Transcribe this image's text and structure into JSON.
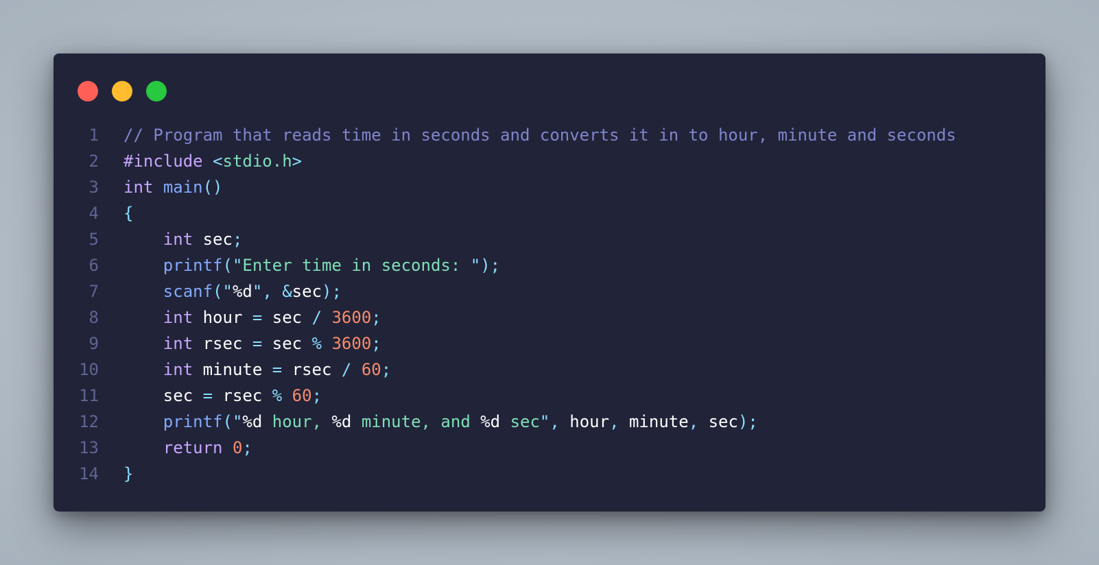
{
  "window": {
    "controls": [
      {
        "name": "close",
        "color": "#ff5f57"
      },
      {
        "name": "minimize",
        "color": "#febc2e"
      },
      {
        "name": "maximize",
        "color": "#28c840"
      }
    ]
  },
  "colors": {
    "background": "#212338",
    "line_number": "#5e6594",
    "comment": "#7f86cc",
    "keyword": "#c7a6ff",
    "function": "#82aaff",
    "punctuation": "#89ddff",
    "string": "#7fe0b8",
    "number": "#f78c6c",
    "identifier": "#ffffff"
  },
  "code": {
    "language": "c",
    "lines": [
      {
        "number": "1",
        "tokens": [
          {
            "t": "comment",
            "v": "// Program that reads time in seconds and converts it in to hour, minute and seconds"
          }
        ]
      },
      {
        "number": "2",
        "tokens": [
          {
            "t": "preproc",
            "v": "#include"
          },
          {
            "t": "ident",
            "v": " "
          },
          {
            "t": "punct",
            "v": "<"
          },
          {
            "t": "header",
            "v": "stdio.h"
          },
          {
            "t": "punct",
            "v": ">"
          }
        ]
      },
      {
        "number": "3",
        "tokens": [
          {
            "t": "keyword",
            "v": "int"
          },
          {
            "t": "ident",
            "v": " "
          },
          {
            "t": "func",
            "v": "main"
          },
          {
            "t": "punct",
            "v": "()"
          }
        ]
      },
      {
        "number": "4",
        "tokens": [
          {
            "t": "punct",
            "v": "{"
          }
        ]
      },
      {
        "number": "5",
        "tokens": [
          {
            "t": "ident",
            "v": "    "
          },
          {
            "t": "keyword",
            "v": "int"
          },
          {
            "t": "ident",
            "v": " sec"
          },
          {
            "t": "punct",
            "v": ";"
          }
        ]
      },
      {
        "number": "6",
        "tokens": [
          {
            "t": "ident",
            "v": "    "
          },
          {
            "t": "func",
            "v": "printf"
          },
          {
            "t": "punct",
            "v": "("
          },
          {
            "t": "punct",
            "v": "\""
          },
          {
            "t": "string",
            "v": "Enter time in seconds: "
          },
          {
            "t": "punct",
            "v": "\""
          },
          {
            "t": "punct",
            "v": ");"
          }
        ]
      },
      {
        "number": "7",
        "tokens": [
          {
            "t": "ident",
            "v": "    "
          },
          {
            "t": "func",
            "v": "scanf"
          },
          {
            "t": "punct",
            "v": "("
          },
          {
            "t": "punct",
            "v": "\""
          },
          {
            "t": "ident",
            "v": "%d"
          },
          {
            "t": "punct",
            "v": "\""
          },
          {
            "t": "punct",
            "v": ", "
          },
          {
            "t": "punct",
            "v": "&"
          },
          {
            "t": "ident",
            "v": "sec"
          },
          {
            "t": "punct",
            "v": ");"
          }
        ]
      },
      {
        "number": "8",
        "tokens": [
          {
            "t": "ident",
            "v": "    "
          },
          {
            "t": "keyword",
            "v": "int"
          },
          {
            "t": "ident",
            "v": " hour "
          },
          {
            "t": "punct",
            "v": "="
          },
          {
            "t": "ident",
            "v": " sec "
          },
          {
            "t": "punct",
            "v": "/"
          },
          {
            "t": "ident",
            "v": " "
          },
          {
            "t": "number",
            "v": "3600"
          },
          {
            "t": "punct",
            "v": ";"
          }
        ]
      },
      {
        "number": "9",
        "tokens": [
          {
            "t": "ident",
            "v": "    "
          },
          {
            "t": "keyword",
            "v": "int"
          },
          {
            "t": "ident",
            "v": " rsec "
          },
          {
            "t": "punct",
            "v": "="
          },
          {
            "t": "ident",
            "v": " sec "
          },
          {
            "t": "punct",
            "v": "%"
          },
          {
            "t": "ident",
            "v": " "
          },
          {
            "t": "number",
            "v": "3600"
          },
          {
            "t": "punct",
            "v": ";"
          }
        ]
      },
      {
        "number": "10",
        "tokens": [
          {
            "t": "ident",
            "v": "    "
          },
          {
            "t": "keyword",
            "v": "int"
          },
          {
            "t": "ident",
            "v": " minute "
          },
          {
            "t": "punct",
            "v": "="
          },
          {
            "t": "ident",
            "v": " rsec "
          },
          {
            "t": "punct",
            "v": "/"
          },
          {
            "t": "ident",
            "v": " "
          },
          {
            "t": "number",
            "v": "60"
          },
          {
            "t": "punct",
            "v": ";"
          }
        ]
      },
      {
        "number": "11",
        "tokens": [
          {
            "t": "ident",
            "v": "    sec "
          },
          {
            "t": "punct",
            "v": "="
          },
          {
            "t": "ident",
            "v": " rsec "
          },
          {
            "t": "punct",
            "v": "%"
          },
          {
            "t": "ident",
            "v": " "
          },
          {
            "t": "number",
            "v": "60"
          },
          {
            "t": "punct",
            "v": ";"
          }
        ]
      },
      {
        "number": "12",
        "tokens": [
          {
            "t": "ident",
            "v": "    "
          },
          {
            "t": "func",
            "v": "printf"
          },
          {
            "t": "punct",
            "v": "("
          },
          {
            "t": "punct",
            "v": "\""
          },
          {
            "t": "ident",
            "v": "%d"
          },
          {
            "t": "string",
            "v": " hour, "
          },
          {
            "t": "ident",
            "v": "%d"
          },
          {
            "t": "string",
            "v": " minute, and "
          },
          {
            "t": "ident",
            "v": "%d"
          },
          {
            "t": "string",
            "v": " sec"
          },
          {
            "t": "punct",
            "v": "\""
          },
          {
            "t": "punct",
            "v": ", "
          },
          {
            "t": "ident",
            "v": "hour"
          },
          {
            "t": "punct",
            "v": ", "
          },
          {
            "t": "ident",
            "v": "minute"
          },
          {
            "t": "punct",
            "v": ", "
          },
          {
            "t": "ident",
            "v": "sec"
          },
          {
            "t": "punct",
            "v": ");"
          }
        ]
      },
      {
        "number": "13",
        "tokens": [
          {
            "t": "ident",
            "v": "    "
          },
          {
            "t": "keyword",
            "v": "return"
          },
          {
            "t": "ident",
            "v": " "
          },
          {
            "t": "number",
            "v": "0"
          },
          {
            "t": "punct",
            "v": ";"
          }
        ]
      },
      {
        "number": "14",
        "tokens": [
          {
            "t": "punct",
            "v": "}"
          }
        ]
      }
    ]
  }
}
